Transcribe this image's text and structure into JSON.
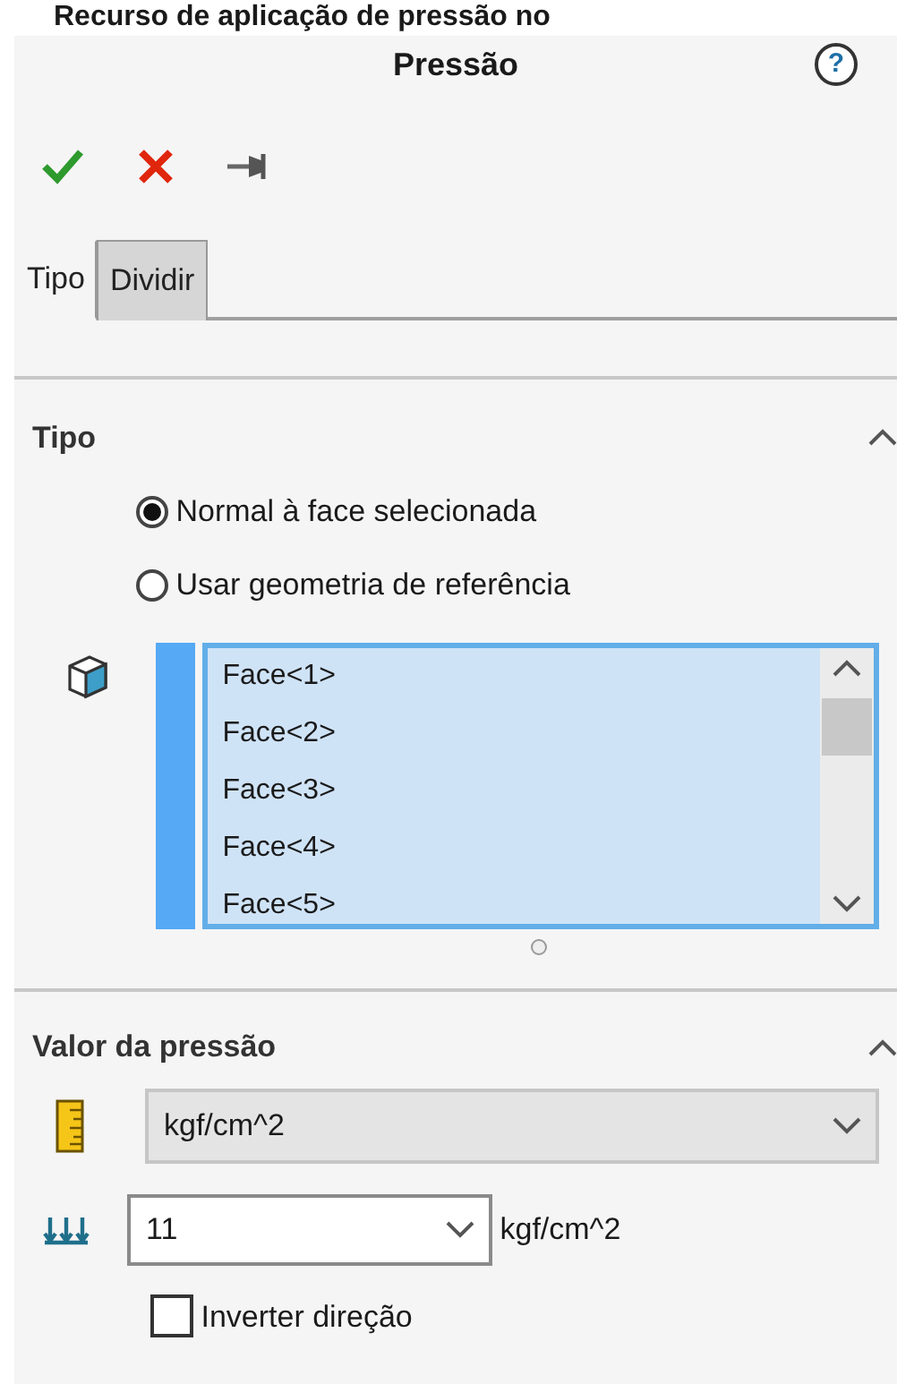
{
  "caption": "Recurso de aplicação de pressão no",
  "panel": {
    "title": "Pressão",
    "help": "?"
  },
  "toolbar": [
    {
      "kind": "ok"
    },
    {
      "kind": "cancel"
    },
    {
      "kind": "pin"
    }
  ],
  "tabs": [
    {
      "label": "Tipo",
      "selected": true
    },
    {
      "label": "Dividir",
      "selected": false
    }
  ],
  "type_section": {
    "title": "Tipo",
    "expanded": true,
    "options": [
      {
        "label": "Normal à face selecionada",
        "selected": true
      },
      {
        "label": "Usar geometria de referência",
        "selected": false
      }
    ],
    "faces": [
      "Face<1>",
      "Face<2>",
      "Face<3>",
      "Face<4>",
      "Face<5>"
    ]
  },
  "value_section": {
    "title": "Valor da pressão",
    "expanded": true,
    "unit_select": "kgf/cm^2",
    "value": "11",
    "value_unit": "kgf/cm^2",
    "invert": {
      "label": "Inverter direção",
      "checked": false
    }
  }
}
